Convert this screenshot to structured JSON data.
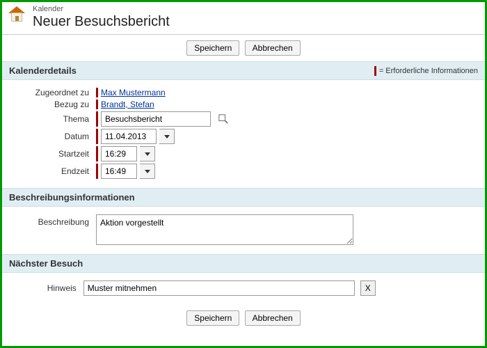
{
  "header": {
    "breadcrumb": "Kalender",
    "title": "Neuer Besuchsbericht"
  },
  "buttons": {
    "save": "Speichern",
    "cancel": "Abbrechen"
  },
  "sections": {
    "details": "Kalenderdetails",
    "description": "Beschreibungsinformationen",
    "next_visit": "Nächster Besuch"
  },
  "legend": {
    "required": "= Erforderliche Informationen"
  },
  "labels": {
    "assigned_to": "Zugeordnet zu",
    "related_to": "Bezug zu",
    "subject": "Thema",
    "date": "Datum",
    "start_time": "Startzeit",
    "end_time": "Endzeit",
    "description": "Beschreibung",
    "hint": "Hinweis"
  },
  "values": {
    "assigned_to": "Max Mustermann",
    "related_to": "Brandt, Stefan",
    "subject": "Besuchsbericht",
    "date": "11.04.2013",
    "start_time": "16:29",
    "end_time": "16:49",
    "description": "Aktion vorgestellt",
    "hint": "Muster mitnehmen",
    "remove_x": "X"
  }
}
